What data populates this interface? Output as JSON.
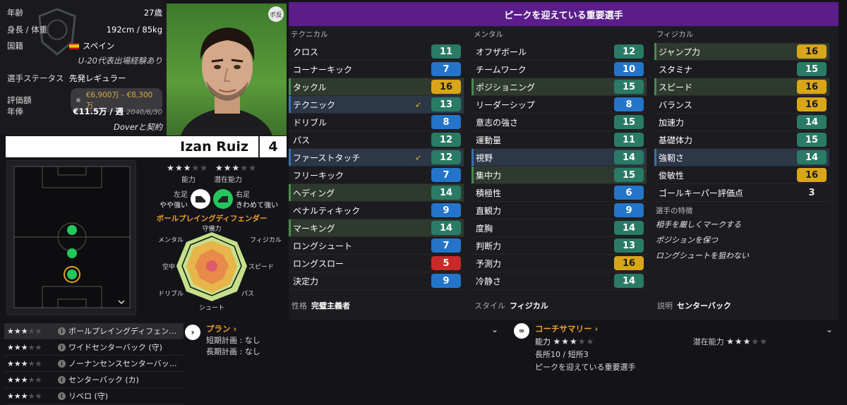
{
  "info": {
    "age_label": "年齢",
    "age": "27歳",
    "height_weight_label": "身長 / 体重",
    "height_weight": "192cm / 85kg",
    "nationality_label": "国籍",
    "nationality": "スペイン",
    "youth_caps": "U-20代表出場経験あり",
    "status_label": "選手ステータス",
    "status": "先発レギュラー",
    "value_label": "評価額",
    "value": "€6,900万 - €8,300万",
    "wage_label": "年俸",
    "wage": "€11.5万 / 週",
    "wage_until": "2040/6/30",
    "contract": "Doverと契約",
    "portrait_badge": "ボ反"
  },
  "player": {
    "name": "Izan Ruiz",
    "number": "4"
  },
  "ratings": {
    "ability_label": "能力",
    "ability_stars": 3,
    "potential_label": "潜在能力",
    "potential_stars": 3,
    "left_foot_label": "左足",
    "left_foot": "やや強い",
    "right_foot_label": "右足",
    "right_foot": "きわめて強い",
    "role": "ボールプレイングディフェンダー"
  },
  "radar": {
    "labels": [
      "守備力",
      "フィジカル",
      "スピード",
      "パス",
      "シュート",
      "ドリブル",
      "空中",
      "メンタル"
    ]
  },
  "attributes": {
    "header": "ピークを迎えている重要選手",
    "technical": {
      "title": "テクニカル",
      "items": [
        {
          "name": "クロス",
          "value": "11",
          "c": "g"
        },
        {
          "name": "コーナーキック",
          "value": "7",
          "c": "b"
        },
        {
          "name": "タックル",
          "value": "16",
          "c": "y",
          "hl": "hl"
        },
        {
          "name": "テクニック",
          "value": "13",
          "c": "g",
          "hl": "hb",
          "arrow": true
        },
        {
          "name": "ドリブル",
          "value": "8",
          "c": "b"
        },
        {
          "name": "パス",
          "value": "12",
          "c": "g"
        },
        {
          "name": "ファーストタッチ",
          "value": "12",
          "c": "g",
          "hl": "hb",
          "arrow": true
        },
        {
          "name": "フリーキック",
          "value": "7",
          "c": "b"
        },
        {
          "name": "ヘディング",
          "value": "14",
          "c": "g",
          "hl": "hl"
        },
        {
          "name": "ペナルティキック",
          "value": "9",
          "c": "b"
        },
        {
          "name": "マーキング",
          "value": "14",
          "c": "g",
          "hl": "hl"
        },
        {
          "name": "ロングシュート",
          "value": "7",
          "c": "b"
        },
        {
          "name": "ロングスロー",
          "value": "5",
          "c": "r"
        },
        {
          "name": "決定力",
          "value": "9",
          "c": "b"
        }
      ],
      "foot_label": "性格",
      "foot_value": "完璧主義者"
    },
    "mental": {
      "title": "メンタル",
      "items": [
        {
          "name": "オフザボール",
          "value": "12",
          "c": "g"
        },
        {
          "name": "チームワーク",
          "value": "10",
          "c": "b"
        },
        {
          "name": "ポジショニング",
          "value": "15",
          "c": "g",
          "hl": "hl"
        },
        {
          "name": "リーダーシップ",
          "value": "8",
          "c": "b"
        },
        {
          "name": "意志の強さ",
          "value": "15",
          "c": "g"
        },
        {
          "name": "運動量",
          "value": "11",
          "c": "g"
        },
        {
          "name": "視野",
          "value": "14",
          "c": "g",
          "hl": "hb"
        },
        {
          "name": "集中力",
          "value": "15",
          "c": "g",
          "hl": "hl"
        },
        {
          "name": "積極性",
          "value": "6",
          "c": "b"
        },
        {
          "name": "直観力",
          "value": "9",
          "c": "b"
        },
        {
          "name": "度胸",
          "value": "14",
          "c": "g"
        },
        {
          "name": "判断力",
          "value": "13",
          "c": "g"
        },
        {
          "name": "予測力",
          "value": "16",
          "c": "y"
        },
        {
          "name": "冷静さ",
          "value": "14",
          "c": "g"
        }
      ],
      "foot_label": "スタイル",
      "foot_value": "フィジカル"
    },
    "physical": {
      "title": "フィジカル",
      "items": [
        {
          "name": "ジャンプ力",
          "value": "16",
          "c": "y",
          "hl": "hl"
        },
        {
          "name": "スタミナ",
          "value": "15",
          "c": "g"
        },
        {
          "name": "スピード",
          "value": "16",
          "c": "y",
          "hl": "hl"
        },
        {
          "name": "バランス",
          "value": "16",
          "c": "y"
        },
        {
          "name": "加速力",
          "value": "14",
          "c": "g"
        },
        {
          "name": "基礎体力",
          "value": "15",
          "c": "g"
        },
        {
          "name": "強靭さ",
          "value": "14",
          "c": "g",
          "hl": "hb"
        },
        {
          "name": "俊敏性",
          "value": "16",
          "c": "y"
        },
        {
          "name": "ゴールキーパー評価点",
          "value": "3",
          "c": "plain"
        }
      ],
      "traits_title": "選手の特徴",
      "traits": [
        "相手を厳しくマークする",
        "ポジションを保つ",
        "ロングシュートを狙わない"
      ],
      "foot_label": "説明",
      "foot_value": "センターバック"
    }
  },
  "roles": [
    {
      "stars": 3,
      "label": "ボールプレイングディフェン…",
      "selected": true
    },
    {
      "stars": 3,
      "label": "ワイドセンターバック (守)"
    },
    {
      "stars": 3,
      "label": "ノーナンセンスセンターバッ…"
    },
    {
      "stars": 3,
      "label": "センターバック (カ)"
    },
    {
      "stars": 3,
      "label": "リベロ (守)"
    }
  ],
  "plan": {
    "title": "プラン ›",
    "short_label": "短期計画 : なし",
    "long_label": "長期計画 : なし"
  },
  "coach": {
    "title": "コーチサマリー ›",
    "ability_label": "能力",
    "ability_stars": 3,
    "potential_label": "潜在能力",
    "potential_stars": 3,
    "strengths": "長所10 / 短所3",
    "summary": "ピークを迎えている重要選手"
  }
}
